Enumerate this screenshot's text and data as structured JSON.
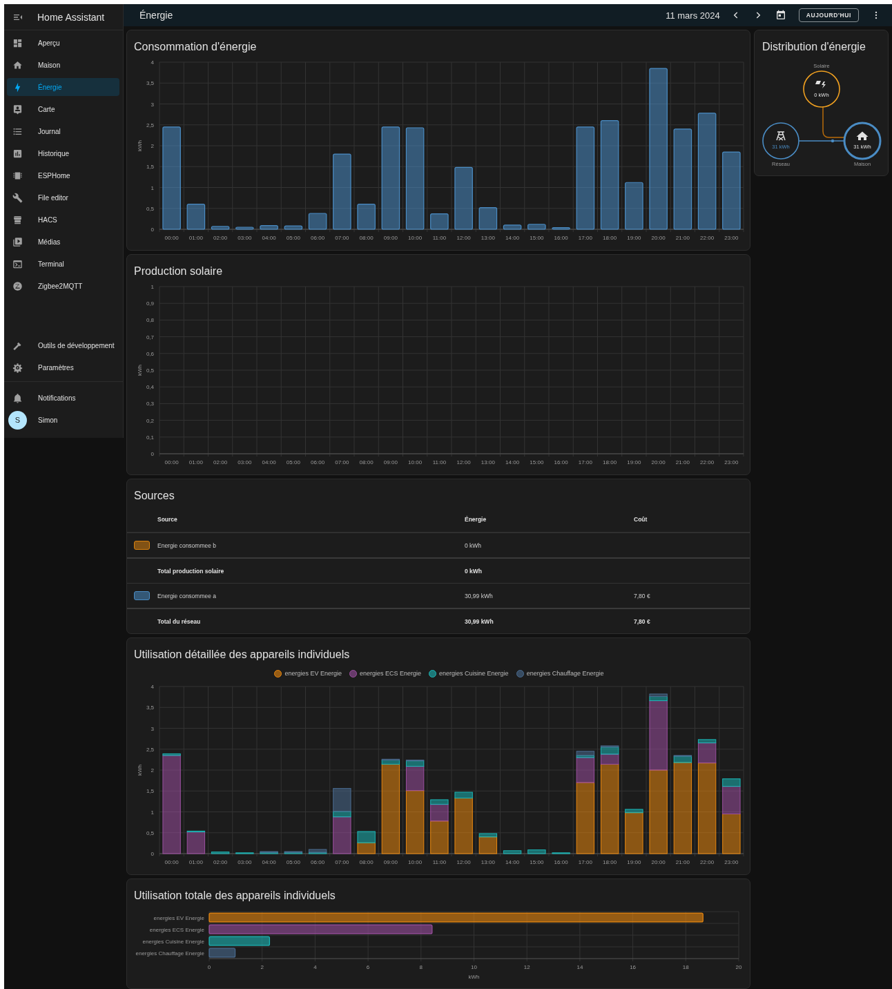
{
  "sidebar": {
    "title": "Home Assistant",
    "items": [
      {
        "label": "Aperçu",
        "selected": false
      },
      {
        "label": "Maison",
        "selected": false
      },
      {
        "label": "Énergie",
        "selected": true
      },
      {
        "label": "Carte",
        "selected": false
      },
      {
        "label": "Journal",
        "selected": false
      },
      {
        "label": "Historique",
        "selected": false
      },
      {
        "label": "ESPHome",
        "selected": false
      },
      {
        "label": "File editor",
        "selected": false
      },
      {
        "label": "HACS",
        "selected": false
      },
      {
        "label": "Médias",
        "selected": false
      },
      {
        "label": "Terminal",
        "selected": false
      },
      {
        "label": "Zigbee2MQTT",
        "selected": false
      }
    ],
    "bottom_items": [
      {
        "label": "Outils de développement",
        "selected": false
      },
      {
        "label": "Paramètres",
        "selected": false
      }
    ],
    "notifications": "Notifications",
    "user": {
      "initial": "S",
      "name": "Simon"
    }
  },
  "topbar": {
    "title": "Énergie",
    "date": "11 mars 2024",
    "today_button": "AUJOURD'HUI"
  },
  "consumption": {
    "title": "Consommation d'énergie",
    "chart_data": {
      "type": "bar",
      "ylabel": "kWh",
      "categories": [
        "00:00",
        "01:00",
        "02:00",
        "03:00",
        "04:00",
        "05:00",
        "06:00",
        "07:00",
        "08:00",
        "09:00",
        "10:00",
        "11:00",
        "12:00",
        "13:00",
        "14:00",
        "15:00",
        "16:00",
        "17:00",
        "18:00",
        "19:00",
        "20:00",
        "21:00",
        "22:00",
        "23:00"
      ],
      "color": "#4a8cc4",
      "grid": true,
      "values": [
        2.45,
        0.6,
        0.07,
        0.05,
        0.09,
        0.08,
        0.38,
        1.8,
        0.6,
        2.45,
        2.43,
        0.37,
        1.48,
        0.52,
        0.1,
        0.12,
        0.04,
        2.45,
        2.6,
        1.12,
        3.85,
        2.4,
        2.78,
        1.85
      ],
      "ylim": [
        0,
        4
      ],
      "yticks": [
        0,
        {
          "value": 0.5,
          "label": "0,5"
        },
        1,
        {
          "value": 1.5,
          "label": "1,5"
        },
        2,
        {
          "value": 2.5,
          "label": "2,5"
        },
        3,
        {
          "value": 3.5,
          "label": "3,5"
        },
        4
      ]
    }
  },
  "production": {
    "title": "Production solaire",
    "chart_data": {
      "type": "bar",
      "ylabel": "kWh",
      "categories": [
        "00:00",
        "01:00",
        "02:00",
        "03:00",
        "04:00",
        "05:00",
        "06:00",
        "07:00",
        "08:00",
        "09:00",
        "10:00",
        "11:00",
        "12:00",
        "13:00",
        "14:00",
        "15:00",
        "16:00",
        "17:00",
        "18:00",
        "19:00",
        "20:00",
        "21:00",
        "22:00",
        "23:00"
      ],
      "grid": true,
      "values": [
        0,
        0,
        0,
        0,
        0,
        0,
        0,
        0,
        0,
        0,
        0,
        0,
        0,
        0,
        0,
        0,
        0,
        0,
        0,
        0,
        0,
        0,
        0,
        0
      ],
      "ylim": [
        0,
        1
      ],
      "yticks": [
        0,
        {
          "value": 0.1,
          "label": "0,1"
        },
        {
          "value": 0.2,
          "label": "0,2"
        },
        {
          "value": 0.3,
          "label": "0,3"
        },
        {
          "value": 0.4,
          "label": "0,4"
        },
        {
          "value": 0.5,
          "label": "0,5"
        },
        {
          "value": 0.6,
          "label": "0,6"
        },
        {
          "value": 0.7,
          "label": "0,7"
        },
        {
          "value": 0.8,
          "label": "0,8"
        },
        {
          "value": 0.9,
          "label": "0,9"
        },
        1
      ]
    }
  },
  "sources": {
    "title": "Sources",
    "columns": [
      "Source",
      "Énergie",
      "Coût"
    ],
    "rows": [
      {
        "kind": "source",
        "color": "#d9820f",
        "source": "Energie consommee b",
        "energy": "0 kWh"
      },
      {
        "kind": "total",
        "source": "Total production solaire",
        "energy": "0 kWh"
      },
      {
        "kind": "source",
        "color": "#4a8cc4",
        "source": "Energie consommee a",
        "energy": "30,99 kWh",
        "cost": "7,80 €"
      },
      {
        "kind": "total",
        "source": "Total du réseau",
        "energy": "30,99 kWh",
        "cost": "7,80 €"
      }
    ]
  },
  "devices_detail": {
    "title": "Utilisation détaillée des appareils individuels",
    "chart_data": {
      "type": "bar",
      "stacked": true,
      "grid": true,
      "ylabel": "kWh",
      "categories": [
        "00:00",
        "01:00",
        "02:00",
        "03:00",
        "04:00",
        "05:00",
        "06:00",
        "07:00",
        "08:00",
        "09:00",
        "10:00",
        "11:00",
        "12:00",
        "13:00",
        "14:00",
        "15:00",
        "16:00",
        "17:00",
        "18:00",
        "19:00",
        "20:00",
        "21:00",
        "22:00",
        "23:00"
      ],
      "series": [
        {
          "name": "energies EV Energie",
          "color": "#e8870f",
          "values": [
            0,
            0,
            0,
            0,
            0,
            0,
            0,
            0,
            0.26,
            2.14,
            1.51,
            0.78,
            1.33,
            0.4,
            0,
            0,
            0,
            1.7,
            2.14,
            0.98,
            2.0,
            2.18,
            2.17,
            0.95
          ]
        },
        {
          "name": "energies ECS Energie",
          "color": "#9a4f9e",
          "values": [
            2.35,
            0.52,
            0,
            0,
            0,
            0,
            0,
            0.88,
            0,
            0,
            0.58,
            0.4,
            0,
            0,
            0,
            0,
            0,
            0.6,
            0.24,
            0,
            1.66,
            0,
            0.48,
            0.66
          ]
        },
        {
          "name": "energies Cuisine Energie",
          "color": "#1cb5b5",
          "values": [
            0.04,
            0.02,
            0.04,
            0.02,
            0.03,
            0.03,
            0.03,
            0.13,
            0.27,
            0.1,
            0.13,
            0.11,
            0.14,
            0.08,
            0.07,
            0.09,
            0.02,
            0.05,
            0.17,
            0.08,
            0.1,
            0.15,
            0.08,
            0.18
          ]
        },
        {
          "name": "energies Chauffage Energie",
          "color": "#4a6b8f",
          "values": [
            0,
            0,
            0,
            0,
            0.02,
            0.02,
            0.07,
            0.55,
            0,
            0.02,
            0.02,
            0,
            0,
            0,
            0,
            0,
            0,
            0.1,
            0.03,
            0,
            0.06,
            0.02,
            0,
            0
          ]
        }
      ],
      "ylim": [
        0,
        4
      ],
      "yticks": [
        0,
        {
          "value": 0.5,
          "label": "0,5"
        },
        1,
        {
          "value": 1.5,
          "label": "1,5"
        },
        2,
        {
          "value": 2.5,
          "label": "2,5"
        },
        3,
        {
          "value": 3.5,
          "label": "3,5"
        },
        4
      ]
    }
  },
  "devices_total": {
    "title": "Utilisation totale des appareils individuels",
    "chart_data": {
      "type": "bar",
      "orientation": "horizontal",
      "grid": true,
      "xlabel": "kWh",
      "categories": [
        "energies EV Energie",
        "energies ECS Energie",
        "energies Cuisine Energie",
        "energies Chauffage Energie"
      ],
      "values": [
        18.65,
        8.42,
        2.28,
        0.98
      ],
      "colors": [
        "#e8870f",
        "#9a4f9e",
        "#1cb5b5",
        "#4a6b8f"
      ],
      "xlim": [
        0,
        20
      ],
      "xticks": [
        0,
        2,
        4,
        6,
        8,
        10,
        12,
        14,
        16,
        18,
        20
      ]
    }
  },
  "distribution": {
    "title": "Distribution d'énergie",
    "nodes": [
      {
        "kind": "solar",
        "label": "Solaire",
        "value": "0 kWh"
      },
      {
        "kind": "grid",
        "label": "Réseau",
        "value": "31 kWh"
      },
      {
        "kind": "home",
        "label": "Maison",
        "value": "31 kWh"
      }
    ]
  }
}
